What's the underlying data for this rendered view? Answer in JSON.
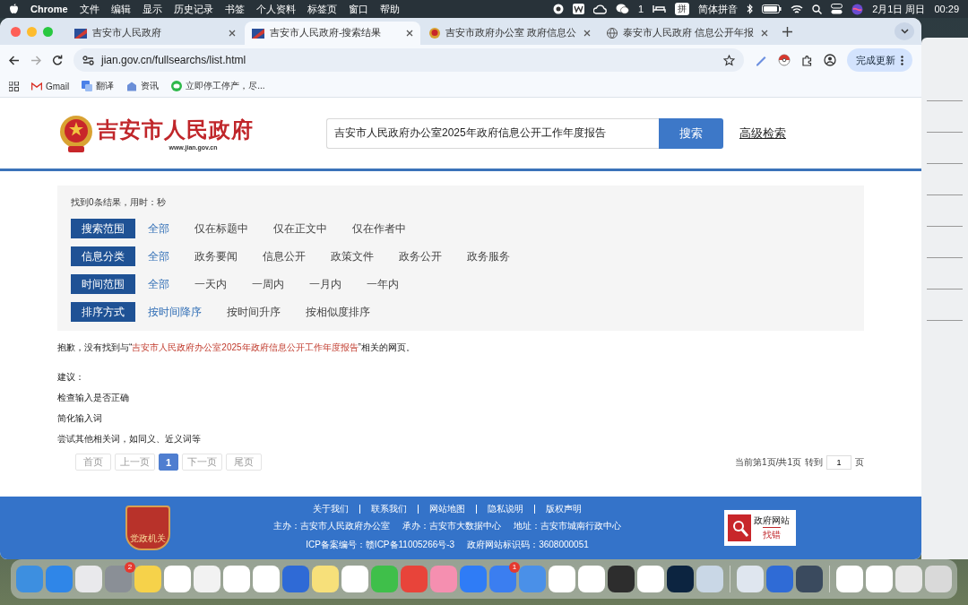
{
  "menubar": {
    "app": "Chrome",
    "menus": [
      "文件",
      "编辑",
      "显示",
      "历史记录",
      "书签",
      "个人资料",
      "标签页",
      "窗口",
      "帮助"
    ],
    "wechat_count": "1",
    "input_key": "拼",
    "input_method": "简体拼音",
    "date": "2月1日 周日",
    "time": "00:29"
  },
  "tabs": [
    {
      "title": "吉安市人民政府",
      "selected": false
    },
    {
      "title": "吉安市人民政府-搜索结果",
      "selected": true
    },
    {
      "title": "吉安市政府办公室 政府信息公",
      "selected": false
    },
    {
      "title": "泰安市人民政府 信息公开年报",
      "selected": false
    }
  ],
  "address": "jian.gov.cn/fullsearchs/list.html",
  "update_button": "完成更新",
  "bookmarks": [
    "Gmail",
    "翻译",
    "资讯",
    "立即停工停产，尽..."
  ],
  "site": {
    "name": "吉安市人民政府",
    "url": "www.jian.gov.cn",
    "search_value": "吉安市人民政府办公室2025年政府信息公开工作年度报告",
    "search_button": "搜索",
    "advanced": "高级检索"
  },
  "summary": "找到0条结果，用时：秒",
  "filters": [
    {
      "label": "搜索范围",
      "options": [
        {
          "label": "全部",
          "selected": true
        },
        {
          "label": "仅在标题中",
          "selected": false
        },
        {
          "label": "仅在正文中",
          "selected": false
        },
        {
          "label": "仅在作者中",
          "selected": false
        }
      ]
    },
    {
      "label": "信息分类",
      "options": [
        {
          "label": "全部",
          "selected": true
        },
        {
          "label": "政务要闻",
          "selected": false
        },
        {
          "label": "信息公开",
          "selected": false
        },
        {
          "label": "政策文件",
          "selected": false
        },
        {
          "label": "政务公开",
          "selected": false
        },
        {
          "label": "政务服务",
          "selected": false
        }
      ]
    },
    {
      "label": "时间范围",
      "options": [
        {
          "label": "全部",
          "selected": true
        },
        {
          "label": "一天内",
          "selected": false
        },
        {
          "label": "一周内",
          "selected": false
        },
        {
          "label": "一月内",
          "selected": false
        },
        {
          "label": "一年内",
          "selected": false
        }
      ]
    },
    {
      "label": "排序方式",
      "options": [
        {
          "label": "按时间降序",
          "selected": true
        },
        {
          "label": "按时间升序",
          "selected": false
        },
        {
          "label": "按相似度排序",
          "selected": false
        }
      ]
    }
  ],
  "no_result": {
    "prefix": "抱歉，没有找到与“",
    "query": "吉安市人民政府办公室2025年政府信息公开工作年度报告",
    "suffix": "”相关的网页。"
  },
  "suggestions": {
    "title": "建议：",
    "items": [
      "检查输入是否正确",
      "简化输入词",
      "尝试其他相关词，如同义、近义词等"
    ]
  },
  "pagination": {
    "items": [
      {
        "label": "首页",
        "selected": false,
        "disabled": true
      },
      {
        "label": "上一页",
        "selected": false,
        "disabled": true
      },
      {
        "label": "1",
        "selected": true,
        "disabled": false
      },
      {
        "label": "下一页",
        "selected": false,
        "disabled": true
      },
      {
        "label": "尾页",
        "selected": false,
        "disabled": true
      }
    ],
    "status": "当前第1页/共1页",
    "goto": "转到",
    "page_value": "1",
    "page_unit": "页"
  },
  "footer": {
    "links": [
      "关于我们",
      "联系我们",
      "网站地图",
      "隐私说明",
      "版权声明"
    ],
    "info": [
      "主办：吉安市人民政府办公室",
      "承办：吉安市大数据中心",
      "地址：吉安市城南行政中心"
    ],
    "icp": [
      "ICP备案编号：赣ICP备11005266号-3",
      "政府网站标识码：3608000051"
    ],
    "party_badge": "党政机关",
    "error_badge": {
      "top": "政府网站",
      "bottom": "找错"
    }
  },
  "dock_badges": [
    "2",
    "1"
  ]
}
